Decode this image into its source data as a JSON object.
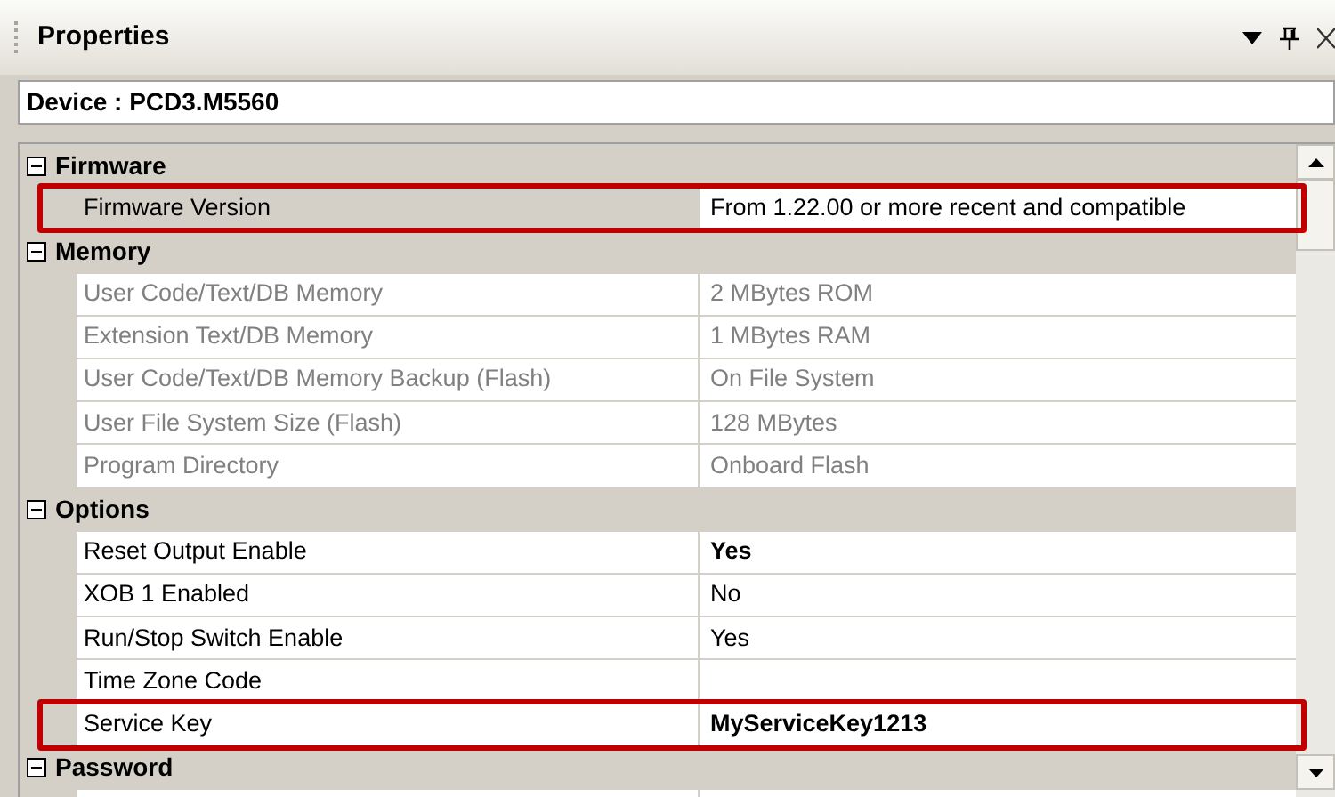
{
  "panel": {
    "title": "Properties"
  },
  "device": {
    "label": "Device : PCD3.M5560"
  },
  "grid": [
    {
      "kind": "category",
      "name": "Firmware",
      "expanded": true
    },
    {
      "kind": "property",
      "name": "Firmware Version",
      "value": "From 1.22.00 or more recent and compatible",
      "readonly": false,
      "modified": false,
      "selected": true,
      "highlighted": true
    },
    {
      "kind": "category",
      "name": "Memory",
      "expanded": true
    },
    {
      "kind": "property",
      "name": "User Code/Text/DB Memory",
      "value": "2 MBytes ROM",
      "readonly": true,
      "modified": false,
      "selected": false,
      "highlighted": false
    },
    {
      "kind": "property",
      "name": "Extension Text/DB Memory",
      "value": "1 MBytes RAM",
      "readonly": true,
      "modified": false,
      "selected": false,
      "highlighted": false
    },
    {
      "kind": "property",
      "name": "User Code/Text/DB Memory Backup (Flash)",
      "value": "On File System",
      "readonly": true,
      "modified": false,
      "selected": false,
      "highlighted": false
    },
    {
      "kind": "property",
      "name": "User File System Size (Flash)",
      "value": "128 MBytes",
      "readonly": true,
      "modified": false,
      "selected": false,
      "highlighted": false
    },
    {
      "kind": "property",
      "name": "Program Directory",
      "value": "Onboard Flash",
      "readonly": true,
      "modified": false,
      "selected": false,
      "highlighted": false
    },
    {
      "kind": "category",
      "name": "Options",
      "expanded": true
    },
    {
      "kind": "property",
      "name": "Reset Output Enable",
      "value": "Yes",
      "readonly": false,
      "modified": true,
      "selected": false,
      "highlighted": false
    },
    {
      "kind": "property",
      "name": "XOB 1 Enabled",
      "value": "No",
      "readonly": false,
      "modified": false,
      "selected": false,
      "highlighted": false
    },
    {
      "kind": "property",
      "name": "Run/Stop Switch Enable",
      "value": "Yes",
      "readonly": false,
      "modified": false,
      "selected": false,
      "highlighted": false
    },
    {
      "kind": "property",
      "name": "Time Zone Code",
      "readonly": false,
      "selected": false,
      "highlighted": false
    },
    {
      "kind": "property",
      "name": "Service Key",
      "value": "MyServiceKey1213",
      "readonly": false,
      "modified": true,
      "selected": false,
      "highlighted": true
    },
    {
      "kind": "category",
      "name": "Password",
      "expanded": true
    },
    {
      "kind": "property",
      "selected": false,
      "highlighted": false
    }
  ]
}
